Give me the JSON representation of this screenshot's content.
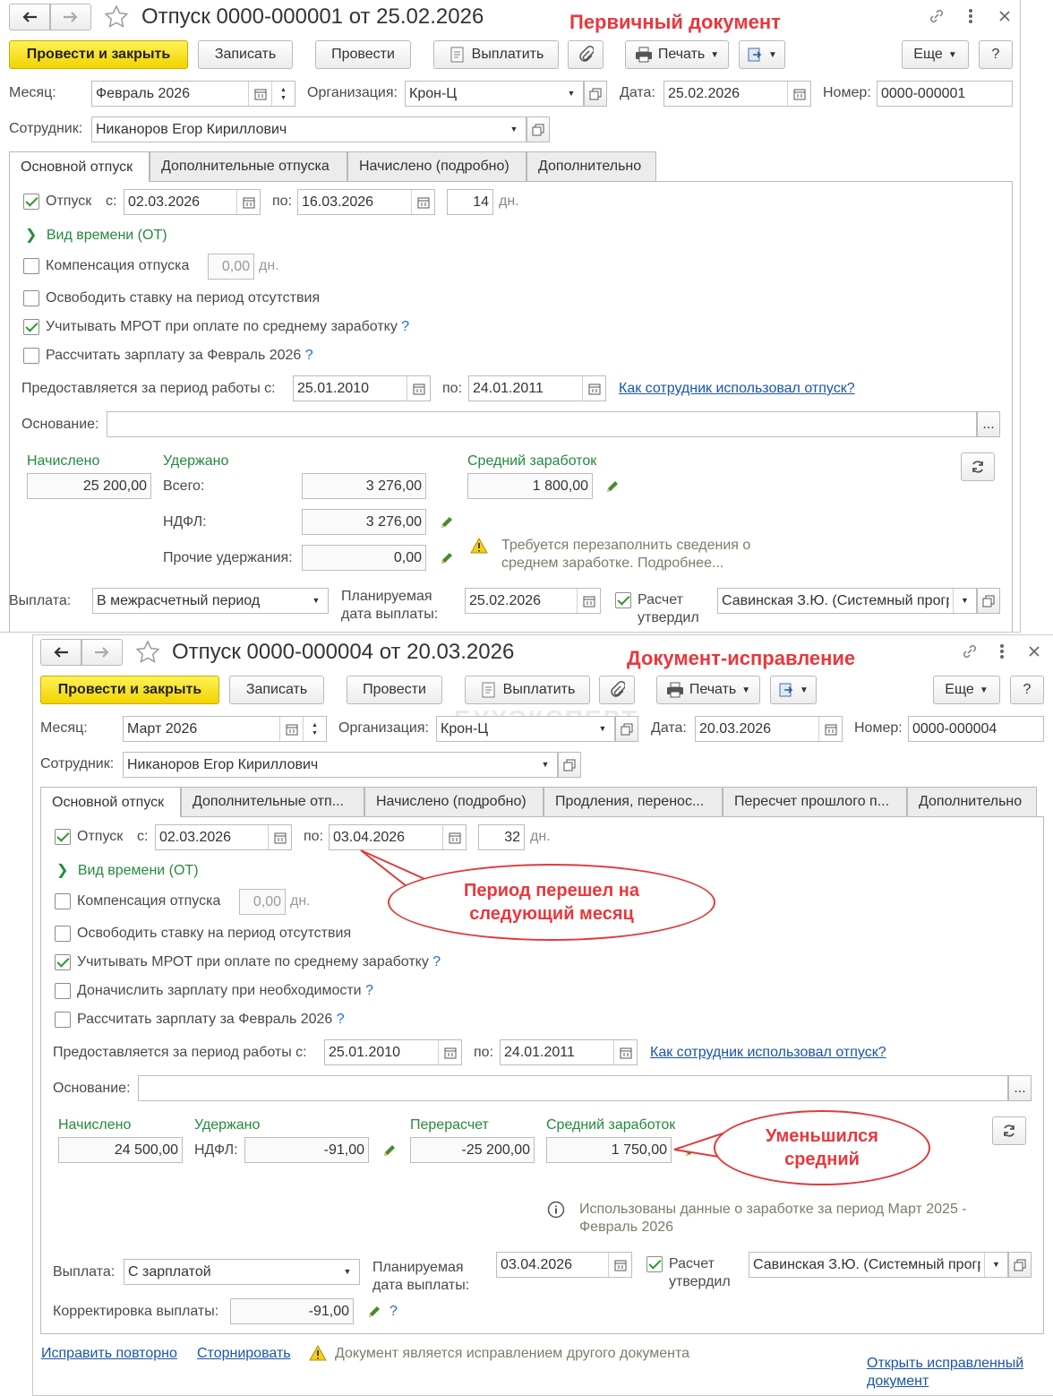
{
  "doc1": {
    "title": "Отпуск 0000-000001 от 25.02.2026",
    "annotation": "Первичный документ",
    "toolbar": {
      "post_close": "Провести и закрыть",
      "save": "Записать",
      "post": "Провести",
      "pay": "Выплатить",
      "print": "Печать",
      "more": "Еще",
      "help": "?"
    },
    "month_label": "Месяц:",
    "month": "Февраль 2026",
    "org_label": "Организация:",
    "org": "Крон-Ц",
    "date_label": "Дата:",
    "date": "25.02.2026",
    "number_label": "Номер:",
    "number": "0000-000001",
    "employee_label": "Сотрудник:",
    "employee": "Никаноров Егор Кириллович",
    "tabs": [
      "Основной отпуск",
      "Дополнительные отпуска",
      "Начислено (подробно)",
      "Дополнительно"
    ],
    "vacation_label": "Отпуск",
    "from_label": "с:",
    "from": "02.03.2026",
    "to_label": "по:",
    "to": "16.03.2026",
    "days": "14",
    "days_unit": "дн.",
    "time_type": "Вид времени (ОТ)",
    "compensation_label": "Компенсация отпуска",
    "compensation": "0,00",
    "compensation_unit": "дн.",
    "release_rate": "Освободить ставку на период отсутствия",
    "mrot": "Учитывать МРОТ при оплате по среднему заработку",
    "calc_salary": "Рассчитать зарплату за Февраль 2026",
    "period_label": "Предоставляется за период работы с:",
    "period_from": "25.01.2010",
    "period_to_label": "по:",
    "period_to": "24.01.2011",
    "usage_link": "Как сотрудник использовал отпуск?",
    "basis_label": "Основание:",
    "basis": "",
    "basis_btn": "...",
    "accrued_label": "Начислено",
    "accrued": "25 200,00",
    "withheld_label": "Удержано",
    "total_label": "Всего:",
    "total": "3 276,00",
    "ndfl_label": "НДФЛ:",
    "ndfl": "3 276,00",
    "other_label": "Прочие удержания:",
    "other": "0,00",
    "avg_label": "Средний заработок",
    "avg": "1 800,00",
    "warning": "Требуется перезаполнить сведения о среднем заработке. Подробнее...",
    "payout_label": "Выплата:",
    "payout": "В межрасчетный период",
    "planned_label": "Планируемая дата выплаты:",
    "planned": "25.02.2026",
    "approved_label": "Расчет утвердил",
    "approver": "Савинская З.Ю. (Системный программист)"
  },
  "doc2": {
    "title": "Отпуск 0000-000004 от 20.03.2026",
    "annotation": "Документ-исправление",
    "toolbar": {
      "post_close": "Провести и закрыть",
      "save": "Записать",
      "post": "Провести",
      "pay": "Выплатить",
      "print": "Печать",
      "more": "Еще",
      "help": "?"
    },
    "month_label": "Месяц:",
    "month": "Март 2026",
    "org_label": "Организация:",
    "org": "Крон-Ц",
    "date_label": "Дата:",
    "date": "20.03.2026",
    "number_label": "Номер:",
    "number": "0000-000004",
    "employee_label": "Сотрудник:",
    "employee": "Никаноров Егор Кириллович",
    "tabs": [
      "Основной отпуск",
      "Дополнительные отп...",
      "Начислено (подробно)",
      "Продления, перенос...",
      "Пересчет прошлого п...",
      "Дополнительно"
    ],
    "vacation_label": "Отпуск",
    "from_label": "с:",
    "from": "02.03.2026",
    "to_label": "по:",
    "to": "03.04.2026",
    "days": "32",
    "days_unit": "дн.",
    "time_type": "Вид времени (ОТ)",
    "compensation_label": "Компенсация отпуска",
    "compensation": "0,00",
    "compensation_unit": "дн.",
    "release_rate": "Освободить ставку на период отсутствия",
    "mrot": "Учитывать МРОТ при оплате по среднему заработку",
    "extra_salary": "Доначислить зарплату при необходимости",
    "calc_salary": "Рассчитать зарплату за Февраль 2026",
    "period_label": "Предоставляется за период работы с:",
    "period_from": "25.01.2010",
    "period_to_label": "по:",
    "period_to": "24.01.2011",
    "usage_link": "Как сотрудник использовал отпуск?",
    "basis_label": "Основание:",
    "basis": "",
    "basis_btn": "...",
    "accrued_label": "Начислено",
    "accrued": "24 500,00",
    "withheld_label": "Удержано",
    "ndfl_label": "НДФЛ:",
    "ndfl": "-91,00",
    "recalc_label": "Перерасчет",
    "recalc": "-25 200,00",
    "avg_label": "Средний заработок",
    "avg": "1 750,00",
    "info": "Использованы данные о заработке за период Март 2025 - Февраль 2026",
    "payout_label": "Выплата:",
    "payout": "С зарплатой",
    "planned_label": "Планируемая дата выплаты:",
    "planned": "03.04.2026",
    "approved_label": "Расчет утвердил",
    "approver": "Савинская З.Ю. (Системный программист)",
    "correction_label": "Корректировка выплаты:",
    "correction": "-91,00",
    "fix_again": "Исправить повторно",
    "storno": "Сторнировать",
    "status": "Документ является исправлением другого документа",
    "open_fixed": "Открыть исправленный документ",
    "bubble_period": "Период перешел на следующий месяц",
    "bubble_avg": "Уменьшился средний",
    "watermark": "БУХЭКСПЕРТ"
  }
}
